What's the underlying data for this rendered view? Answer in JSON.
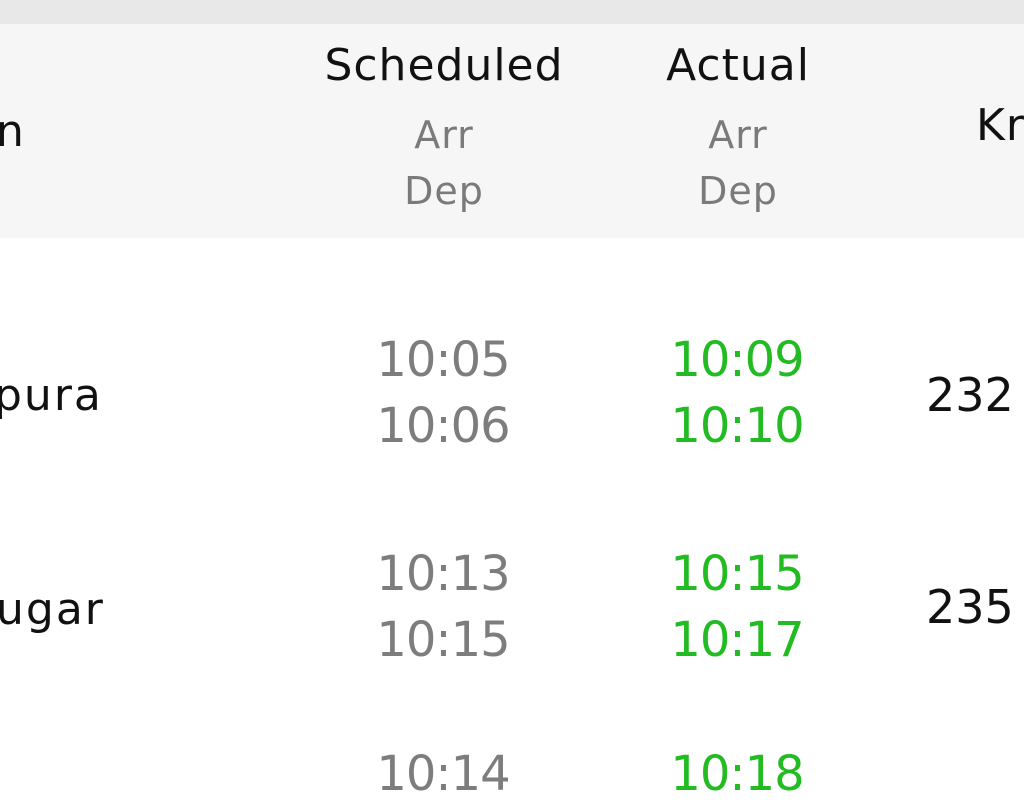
{
  "header": {
    "station_col": "n",
    "scheduled": {
      "title": "Scheduled",
      "arr": "Arr",
      "dep": "Dep"
    },
    "actual": {
      "title": "Actual",
      "arr": "Arr",
      "dep": "Dep"
    },
    "km_col": "Kr"
  },
  "stops": [
    {
      "station": "pura",
      "sched_arr": "10:05",
      "sched_dep": "10:06",
      "act_arr": "10:09",
      "act_dep": "10:10",
      "km": "232"
    },
    {
      "station": "ugar",
      "sched_arr": "10:13",
      "sched_dep": "10:15",
      "act_arr": "10:15",
      "act_dep": "10:17",
      "km": "235"
    },
    {
      "station": "",
      "sched_arr": "10:14",
      "sched_dep": "",
      "act_arr": "10:18",
      "act_dep": "",
      "km": ""
    }
  ],
  "colors": {
    "on_time_green": "#22bb22",
    "scheduled_gray": "#7d7d7d",
    "header_bg": "#f6f6f6"
  }
}
